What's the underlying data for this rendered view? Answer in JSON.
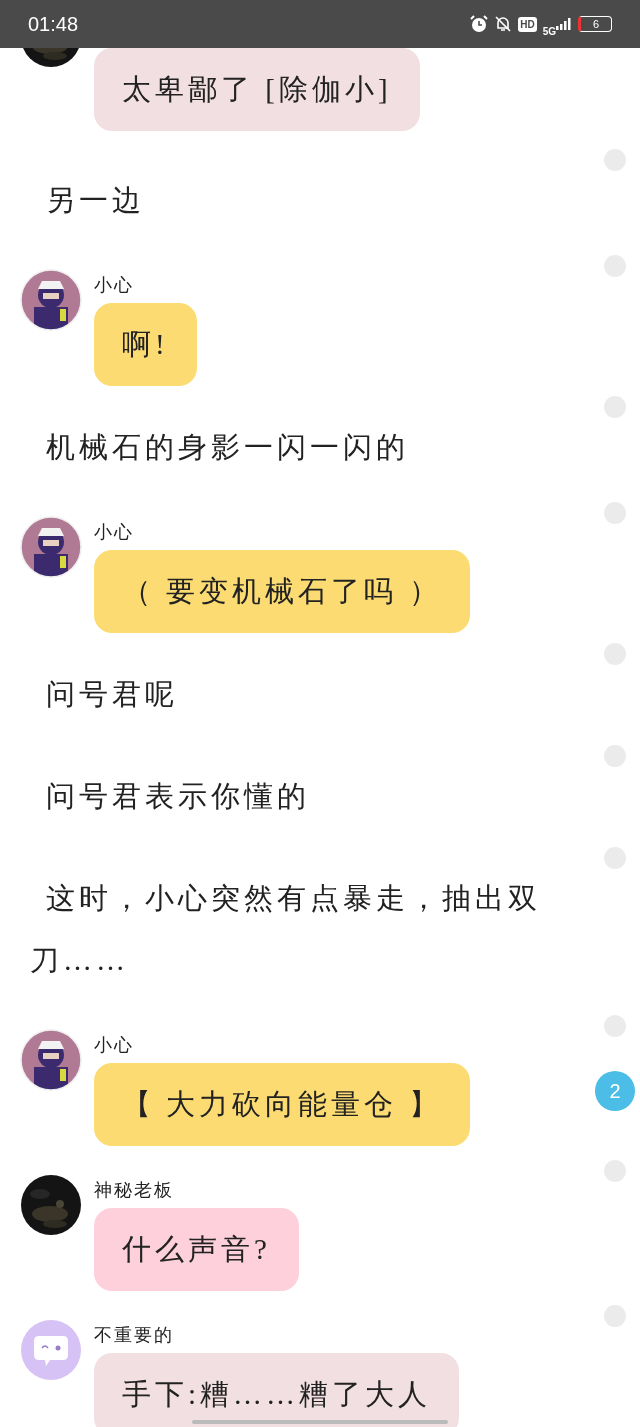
{
  "status_bar": {
    "time": "01:48",
    "hd": "HD",
    "network": "5G",
    "battery": "6"
  },
  "items": [
    {
      "kind": "message",
      "avatar": {
        "kind": "dark"
      },
      "text": "太卑鄙了 [除伽小]",
      "color": "#f2dfe1"
    },
    {
      "kind": "narration",
      "text": "另一边"
    },
    {
      "kind": "message",
      "avatar": {
        "kind": "hero"
      },
      "name": "小心",
      "text": "啊!",
      "color": "#fcdc72"
    },
    {
      "kind": "narration",
      "text": "机械石的身影一闪一闪的"
    },
    {
      "kind": "message",
      "avatar": {
        "kind": "hero"
      },
      "name": "小心",
      "text": "（ 要变机械石了吗 ）",
      "color": "#fcdc72"
    },
    {
      "kind": "narration",
      "text": "问号君呢"
    },
    {
      "kind": "narration",
      "text": "问号君表示你懂的"
    },
    {
      "kind": "narration",
      "text": "这时，小心突然有点暴走，抽出双刀……"
    },
    {
      "kind": "message",
      "avatar": {
        "kind": "hero"
      },
      "name": "小心",
      "text": "【 大力砍向能量仓 】",
      "color": "#fcdc72",
      "badge": "2"
    },
    {
      "kind": "message",
      "avatar": {
        "kind": "dark"
      },
      "name": "神秘老板",
      "text": "什么声音?",
      "color": "#fdd0dc"
    },
    {
      "kind": "message",
      "avatar": {
        "kind": "bubble"
      },
      "name": "不重要的",
      "text": "手下:糟……糟了大人",
      "color": "#f2dfe1"
    }
  ]
}
